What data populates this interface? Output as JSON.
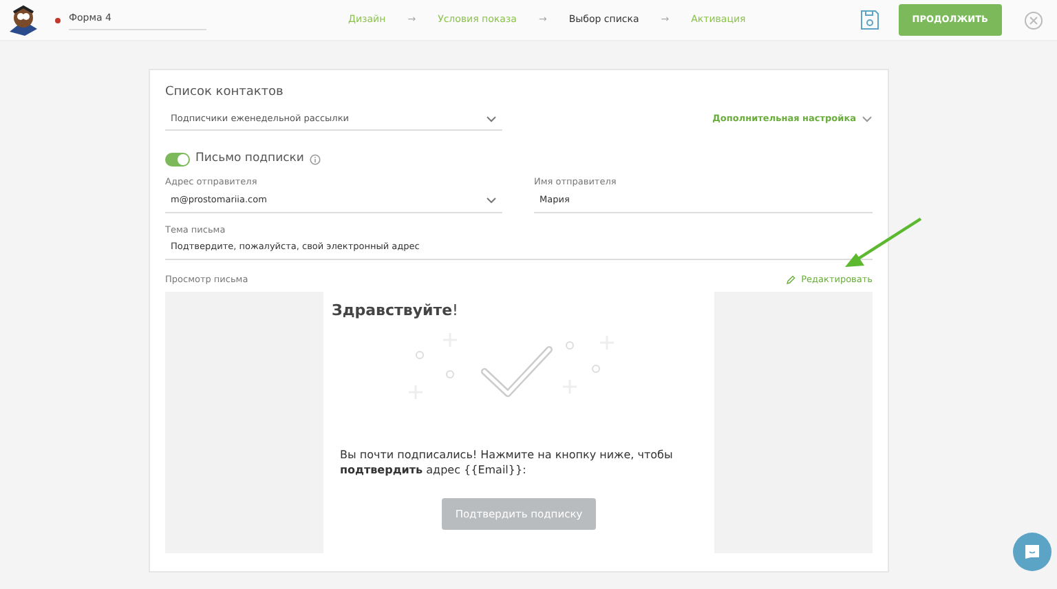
{
  "header": {
    "form_name": "Форма 4",
    "steps": [
      {
        "label": "Дизайн",
        "selected": false
      },
      {
        "label": "Условия показа",
        "selected": false
      },
      {
        "label": "Выбор списка",
        "selected": true
      },
      {
        "label": "Активация",
        "selected": false
      }
    ],
    "step_separator": "→",
    "continue_button": "ПРОДОЛЖИТЬ"
  },
  "form": {
    "contacts_title": "Список контактов",
    "contact_list": "Подписчики еженедельной рассылки",
    "advanced_link": "Дополнительная настройка",
    "subscription_toggle": {
      "label": "Письмо подписки",
      "on": true
    },
    "sender_address": {
      "label": "Адрес отправителя",
      "value": "m@prostomariia.com"
    },
    "sender_name": {
      "label": "Имя отправителя",
      "value": "Мария"
    },
    "subject": {
      "label": "Тема письма",
      "value": "Подтвердите, пожалуйста, свой электронный адрес"
    },
    "preview_label": "Просмотр письма",
    "edit_link": "Редактировать"
  },
  "preview": {
    "greeting": "**Здравствуйте**!",
    "message": "Вы почти подписались! Нажмите на кнопку ниже, чтобы **подтвердить** адрес {{Email}}:",
    "confirm_button": "Подтвердить подписку"
  }
}
